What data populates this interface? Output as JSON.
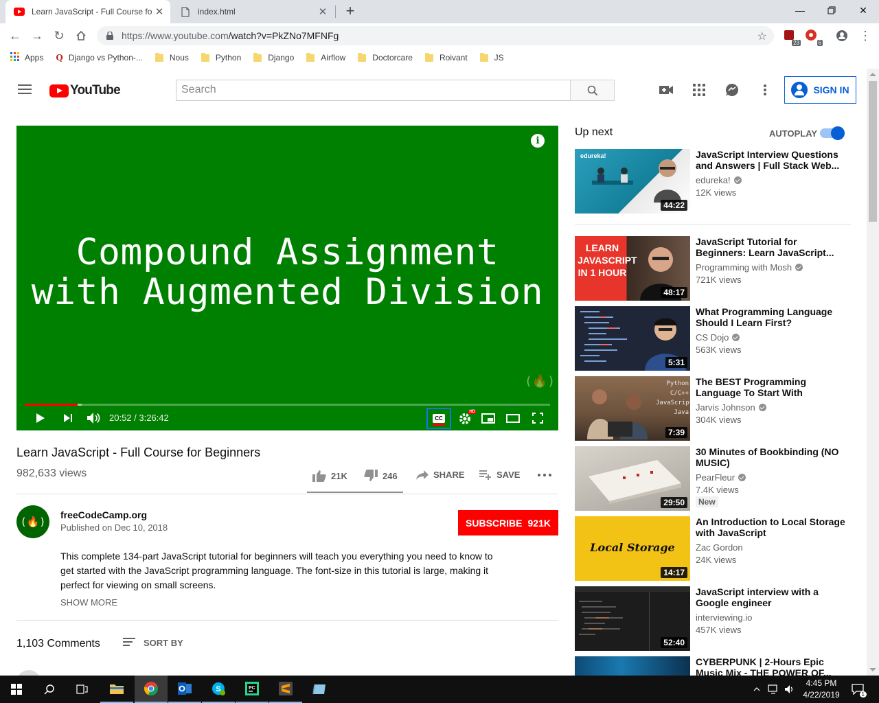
{
  "browser": {
    "tabs": [
      {
        "title": "Learn JavaScript - Full Course for",
        "active": true
      },
      {
        "title": "index.html",
        "active": false
      }
    ],
    "url_host": "https://www.youtube.com",
    "url_path": "/watch?v=PkZNo7MFNFg",
    "ext_badges": [
      "23",
      "6"
    ],
    "bookmarks": [
      "Apps",
      "Django vs Python-...",
      "Nous",
      "Python",
      "Django",
      "Airflow",
      "Doctorcare",
      "Roivant",
      "JS"
    ]
  },
  "header": {
    "logo_text": "YouTube",
    "search_placeholder": "Search",
    "signin_label": "SIGN IN"
  },
  "player": {
    "slide_line1": "Compound Assignment",
    "slide_line2": "with Augmented Division",
    "watermark": "(🔥)",
    "time": "20:52 / 3:26:42",
    "progress_fraction": 0.1,
    "buffered_fraction": 0.108,
    "cc_label": "CC",
    "hd_badge": "HD"
  },
  "video": {
    "title": "Learn JavaScript - Full Course for Beginners",
    "views": "982,633 views",
    "likes": "21K",
    "dislikes": "246",
    "share_label": "SHARE",
    "save_label": "SAVE",
    "channel": "freeCodeCamp.org",
    "channel_avatar": "(🔥)",
    "published": "Published on Dec 10, 2018",
    "subscribe_label": "SUBSCRIBE",
    "subscribers": "921K",
    "description": "This complete 134-part JavaScript tutorial for beginners will teach you everything you need to know to get started with the JavaScript programming language. The font-size in this tutorial is large, making it perfect for viewing on small screens.",
    "show_more": "SHOW MORE",
    "comments_count": "1,103 Comments",
    "sort_by": "SORT BY"
  },
  "sidebar": {
    "up_next": "Up next",
    "autoplay": "AUTOPLAY",
    "autoplay_on": true,
    "items": [
      {
        "title": "JavaScript Interview Questions and Answers | Full Stack Web...",
        "channel": "edureka!",
        "views": "12K views",
        "duration": "44:22",
        "thumb_color": "#1d8fa8",
        "thumb_text": "edureka!"
      },
      {
        "title": "JavaScript Tutorial for Beginners: Learn JavaScript...",
        "channel": "Programming with Mosh",
        "views": "721K views",
        "duration": "48:17",
        "thumb_color": "#e33b2e",
        "thumb_text": "LEARN JAVASCRIPT IN 1 HOUR"
      },
      {
        "title": "What Programming Language Should I Learn First?",
        "channel": "CS Dojo",
        "views": "563K views",
        "duration": "5:31",
        "thumb_color": "#1f2a44",
        "thumb_text": ""
      },
      {
        "title": "The BEST Programming Language To Start With",
        "channel": "Jarvis Johnson",
        "views": "304K views",
        "duration": "7:39",
        "thumb_color": "#8a6a4d",
        "thumb_text": "Python C/C++ JavaScript Java"
      },
      {
        "title": "30 Minutes of Bookbinding (NO MUSIC)",
        "channel": "PearFleur",
        "views": "7.4K views",
        "duration": "29:50",
        "thumb_color": "#b5b1aa",
        "thumb_text": "",
        "badge": "New"
      },
      {
        "title": "An Introduction to Local Storage with JavaScript",
        "channel": "Zac Gordon",
        "views": "24K views",
        "duration": "14:17",
        "thumb_color": "#f2c215",
        "thumb_text": "Local Storage"
      },
      {
        "title": "JavaScript interview with a Google engineer",
        "channel": "interviewing.io",
        "views": "457K views",
        "duration": "52:40",
        "thumb_color": "#1c1c1c",
        "thumb_text": ""
      },
      {
        "title": "CYBERPUNK | 2-Hours Epic Music Mix - THE POWER OF...",
        "channel": "",
        "views": "",
        "duration": "",
        "thumb_color": "#0e4a74",
        "thumb_text": ""
      }
    ]
  },
  "taskbar": {
    "time": "4:45 PM",
    "date": "4/22/2019",
    "notification_count": "1"
  }
}
